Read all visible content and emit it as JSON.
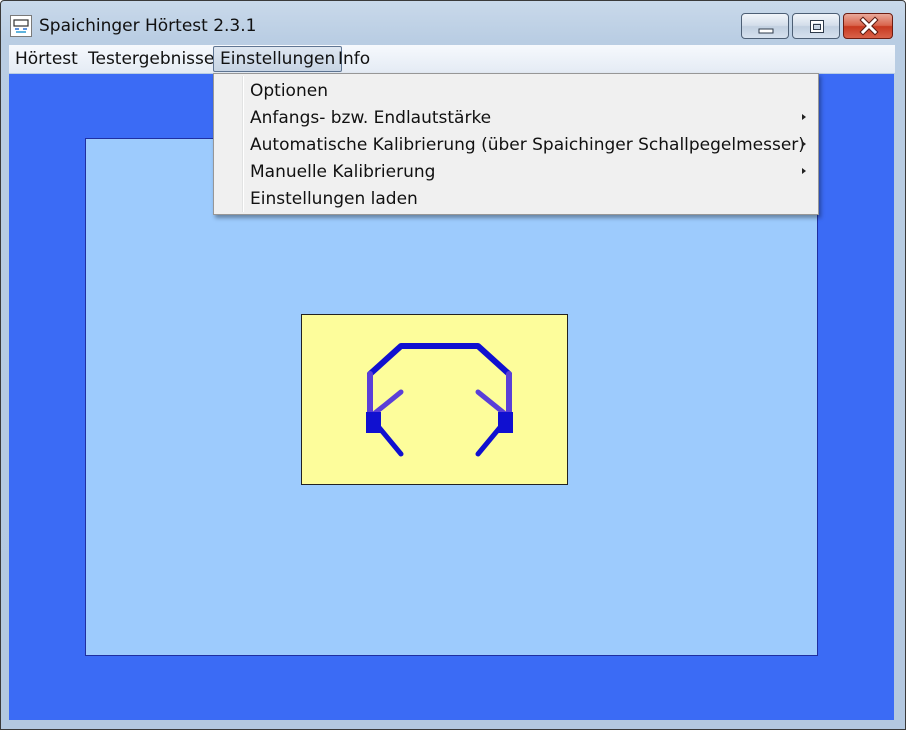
{
  "window": {
    "title": "Spaichinger Hörtest 2.3.1"
  },
  "menubar": {
    "items": [
      {
        "label": "Hörtest"
      },
      {
        "label": "Testergebnisse"
      },
      {
        "label": "Einstellungen",
        "active": true
      },
      {
        "label": "Info"
      }
    ]
  },
  "dropdown": {
    "items": [
      {
        "label": "Optionen",
        "submenu": false
      },
      {
        "label": "Anfangs- bzw. Endlautstärke",
        "submenu": true
      },
      {
        "label": "Automatische Kalibrierung (über Spaichinger Schallpegelmesser)",
        "submenu": true
      },
      {
        "label": "Manuelle Kalibrierung",
        "submenu": true
      },
      {
        "label": "Einstellungen laden",
        "submenu": false
      }
    ]
  },
  "icons": {
    "app": "app-logo-icon",
    "minimize": "minimize-icon",
    "maximize": "maximize-icon",
    "close": "close-icon",
    "headphones": "headphones-icon",
    "submenu": "chevron-right-icon"
  },
  "colors": {
    "client_background": "#3b6bf5",
    "panel_background": "#9dcbfd",
    "image_background": "#fdfd9b",
    "headphones_stroke": "#1010d0",
    "close_button": "#c7381f"
  }
}
